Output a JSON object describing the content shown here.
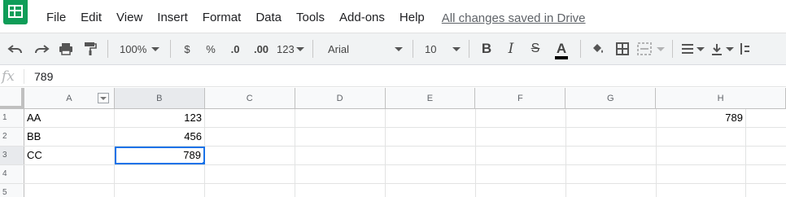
{
  "app": {
    "title": "",
    "menu": [
      "File",
      "Edit",
      "View",
      "Insert",
      "Format",
      "Data",
      "Tools",
      "Add-ons",
      "Help"
    ],
    "save_status": "All changes saved in Drive"
  },
  "toolbar": {
    "zoom": "100%",
    "currency": "$",
    "percent": "%",
    "decrease_decimals": ".0",
    "increase_decimals": ".00",
    "more_formats": "123",
    "font_family": "Arial",
    "font_size": "10",
    "bold": "B",
    "italic": "I",
    "strikethrough": "S",
    "text_color": "A"
  },
  "formula_bar": {
    "fx_label": "fx",
    "value": "789"
  },
  "sheet": {
    "columns": [
      "A",
      "B",
      "C",
      "D",
      "E",
      "F",
      "G",
      "H"
    ],
    "rows": [
      {
        "num": "1",
        "cells": [
          "AA",
          "123",
          "",
          "",
          "",
          "",
          "",
          "789"
        ]
      },
      {
        "num": "2",
        "cells": [
          "BB",
          "456",
          "",
          "",
          "",
          "",
          "",
          ""
        ]
      },
      {
        "num": "3",
        "cells": [
          "CC",
          "789",
          "",
          "",
          "",
          "",
          "",
          ""
        ]
      },
      {
        "num": "4",
        "cells": [
          "",
          "",
          "",
          "",
          "",
          "",
          "",
          ""
        ]
      },
      {
        "num": "5",
        "cells": [
          "",
          "",
          "",
          "",
          "",
          "",
          "",
          ""
        ]
      }
    ],
    "active_cell": "B3",
    "selection_color": "#1a73e8"
  }
}
